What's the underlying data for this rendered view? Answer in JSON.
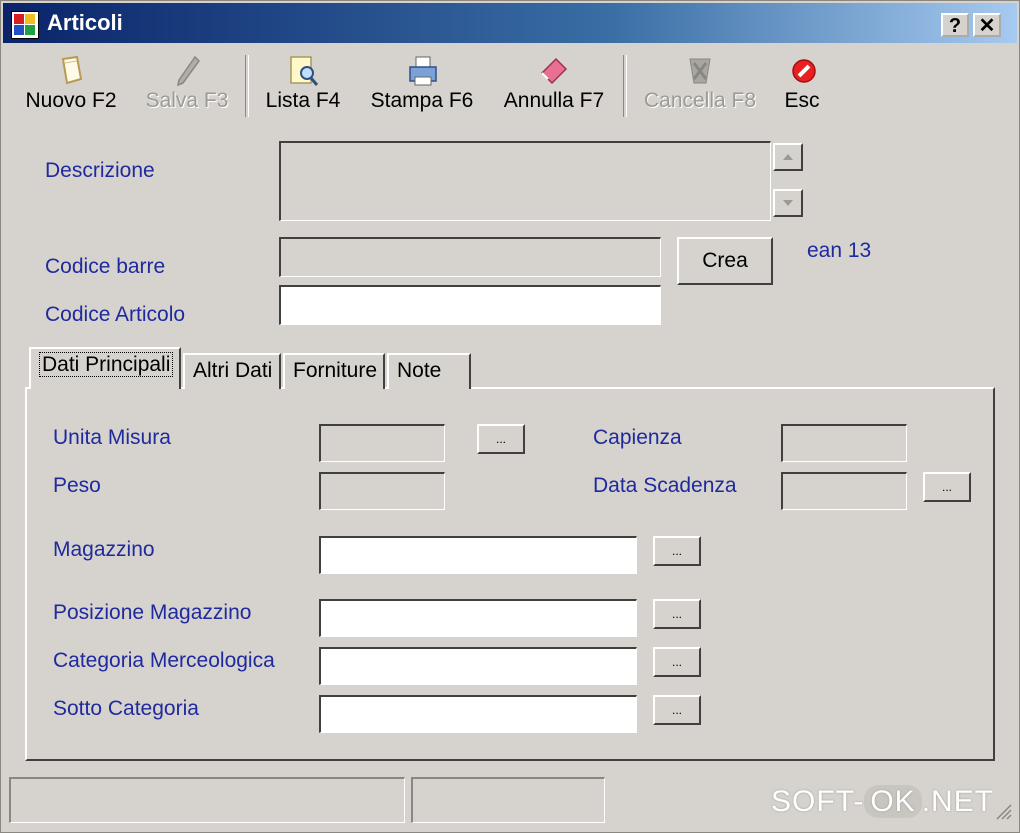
{
  "window": {
    "title": "Articoli",
    "help_label": "?",
    "close_label": "✕"
  },
  "toolbar": [
    {
      "label": "Nuovo F2",
      "icon": "new-document-icon",
      "enabled": true
    },
    {
      "label": "Salva F3",
      "icon": "pencil-icon",
      "enabled": false
    },
    {
      "label": "Lista F4",
      "icon": "list-search-icon",
      "enabled": true
    },
    {
      "label": "Stampa F6",
      "icon": "printer-icon",
      "enabled": true
    },
    {
      "label": "Annulla F7",
      "icon": "eraser-icon",
      "enabled": true
    },
    {
      "label": "Cancella F8",
      "icon": "delete-icon",
      "enabled": false
    },
    {
      "label": "Esc",
      "icon": "stop-icon",
      "enabled": true
    }
  ],
  "form": {
    "descrizione_label": "Descrizione",
    "descrizione_value": "",
    "codice_barre_label": "Codice barre",
    "codice_barre_value": "",
    "crea_label": "Crea",
    "ean_label": "ean 13",
    "codice_articolo_label": "Codice Articolo",
    "codice_articolo_value": ""
  },
  "tabs": [
    {
      "label": "Dati Principali",
      "active": true
    },
    {
      "label": "Altri Dati",
      "active": false
    },
    {
      "label": "Forniture",
      "active": false
    },
    {
      "label": "Note",
      "active": false
    }
  ],
  "panel": {
    "unita_misura_label": "Unita Misura",
    "peso_label": "Peso",
    "capienza_label": "Capienza",
    "data_scadenza_label": "Data Scadenza",
    "magazzino_label": "Magazzino",
    "posizione_magazzino_label": "Posizione Magazzino",
    "categoria_merceologica_label": "Categoria Merceologica",
    "sotto_categoria_label": "Sotto Categoria",
    "browse_label": "..."
  },
  "watermark": {
    "left": "SOFT-",
    "ok": "OK",
    "right": ".NET"
  }
}
